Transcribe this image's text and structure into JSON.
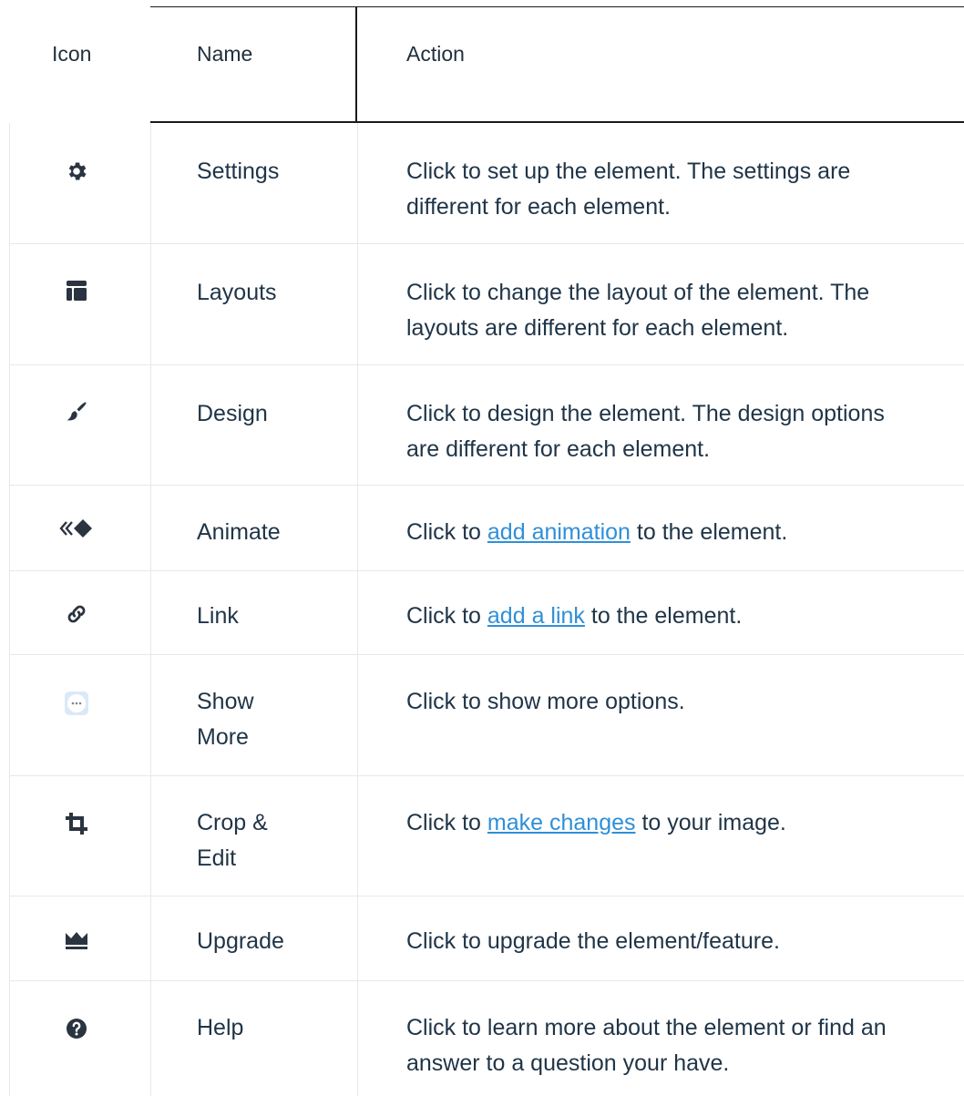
{
  "header": {
    "icon": "Icon",
    "name": "Name",
    "action": "Action"
  },
  "rows": [
    {
      "icon": "gear-icon",
      "name": "Settings",
      "action_pre": "Click to set up the element. The settings are different for each element.",
      "link": "",
      "action_post": ""
    },
    {
      "icon": "layout-icon",
      "name": "Layouts",
      "action_pre": "Click to change the layout of the element. The layouts are different for each element.",
      "link": "",
      "action_post": ""
    },
    {
      "icon": "brush-icon",
      "name": "Design",
      "action_pre": "Click to design the element. The design options are different for each element.",
      "link": "",
      "action_post": ""
    },
    {
      "icon": "animate-icon",
      "name": "Animate",
      "action_pre": "Click to ",
      "link": "add animation",
      "action_post": " to the element."
    },
    {
      "icon": "link-icon",
      "name": "Link",
      "action_pre": "Click to ",
      "link": "add a link",
      "action_post": " to the element."
    },
    {
      "icon": "show-more-icon",
      "name": "Show More",
      "action_pre": "Click to show more options.",
      "link": "",
      "action_post": ""
    },
    {
      "icon": "crop-icon",
      "name": "Crop & Edit",
      "action_pre": "Click to ",
      "link": "make changes",
      "action_post": " to your image."
    },
    {
      "icon": "crown-icon",
      "name": "Upgrade",
      "action_pre": "Click to upgrade the element/feature.",
      "link": "",
      "action_post": ""
    },
    {
      "icon": "help-icon",
      "name": "Help",
      "action_pre": "Click to learn more about the element or find an answer to a question your have.",
      "link": "",
      "action_post": ""
    }
  ],
  "colors": {
    "text": "#1f3447",
    "link": "#2f8fd8",
    "icon": "#2a3440",
    "show_more_bg": "#dbe9f7"
  }
}
